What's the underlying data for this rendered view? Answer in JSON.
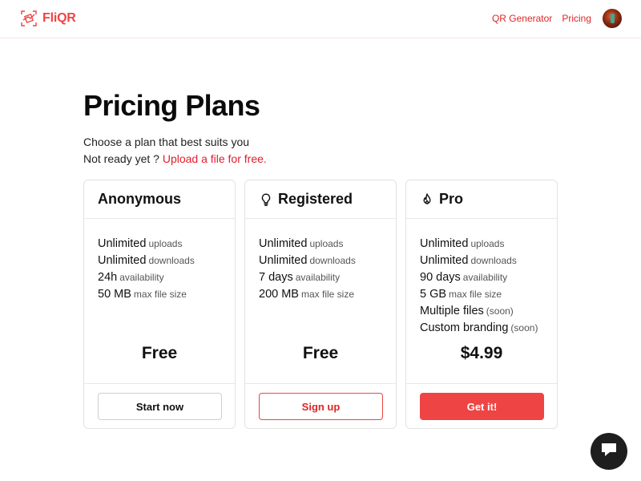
{
  "header": {
    "brand": "FliQR",
    "nav": [
      {
        "label": "QR Generator"
      },
      {
        "label": "Pricing"
      }
    ]
  },
  "main": {
    "title": "Pricing Plans",
    "subtitle": "Choose a plan that best suits you",
    "not_ready_prefix": "Not ready yet ?",
    "not_ready_link": "Upload a file for free."
  },
  "plans": [
    {
      "name": "Anonymous",
      "icon": null,
      "features": [
        {
          "main": "Unlimited",
          "muted": "uploads"
        },
        {
          "main": "Unlimited",
          "muted": "downloads"
        },
        {
          "main": "24h",
          "muted": "availability"
        },
        {
          "main": "50 MB",
          "muted": "max file size"
        }
      ],
      "price": "Free",
      "button": "Start now"
    },
    {
      "name": "Registered",
      "icon": "lightbulb-icon",
      "features": [
        {
          "main": "Unlimited",
          "muted": "uploads"
        },
        {
          "main": "Unlimited",
          "muted": "downloads"
        },
        {
          "main": "7 days",
          "muted": "availability"
        },
        {
          "main": "200 MB",
          "muted": "max file size"
        }
      ],
      "price": "Free",
      "button": "Sign up"
    },
    {
      "name": "Pro",
      "icon": "flame-icon",
      "features": [
        {
          "main": "Unlimited",
          "muted": "uploads"
        },
        {
          "main": "Unlimited",
          "muted": "downloads"
        },
        {
          "main": "90 days",
          "muted": "availability"
        },
        {
          "main": "5 GB",
          "muted": "max file size"
        },
        {
          "main": "Multiple files",
          "muted": "(soon)"
        },
        {
          "main": "Custom branding",
          "muted": "(soon)"
        }
      ],
      "price": "$4.99",
      "button": "Get it!"
    }
  ],
  "colors": {
    "accent": "#ef4444",
    "link": "#e11d2a",
    "chat_bg": "#1e1e1e"
  },
  "icons": {
    "brand": "fliqr-logo-icon",
    "chat": "chat-bubble-icon"
  }
}
